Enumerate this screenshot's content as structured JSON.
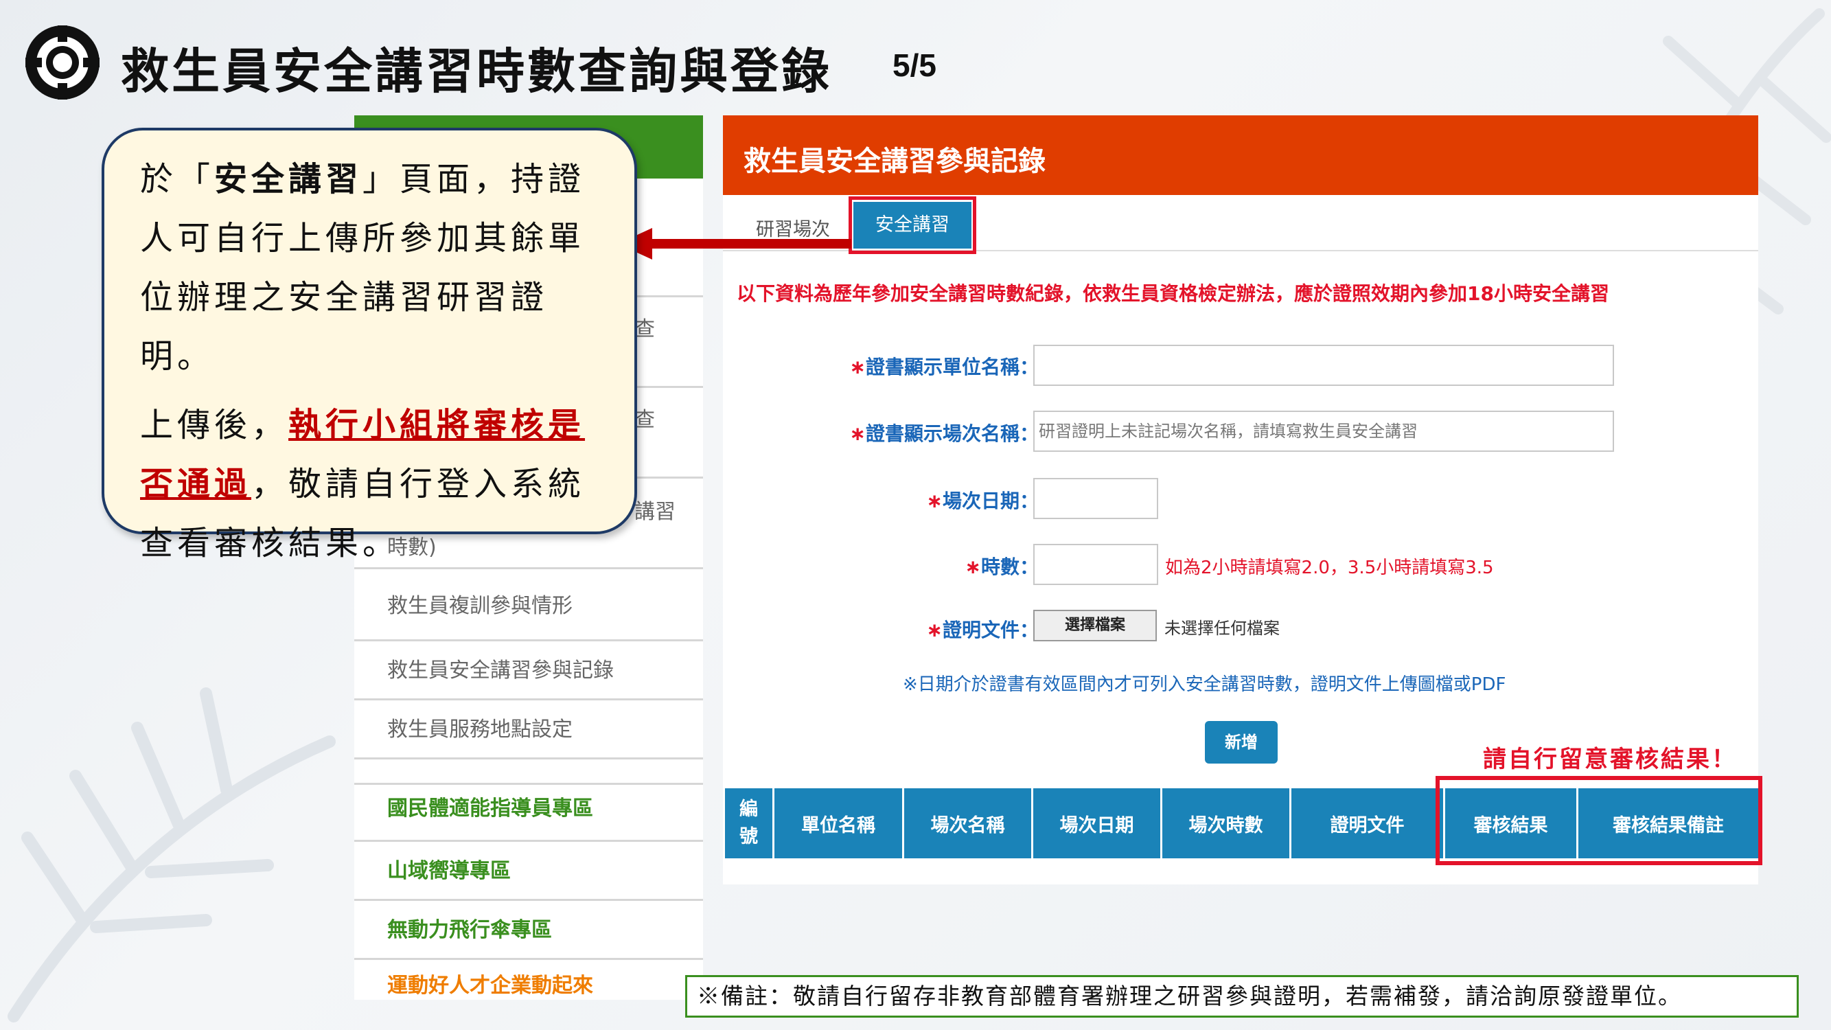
{
  "slide": {
    "title": "救生員安全講習時數查詢與登錄",
    "page": "5/5"
  },
  "callout": {
    "p1_pre": "於「",
    "p1_bold": "安全講習",
    "p1_post": "」頁面，持證人可自行上傳所參加其餘單位辦理之安全講習研習證明。",
    "p2_pre": "上傳後，",
    "p2_red": "執行小組將審核是否通過",
    "p2_post": "，敬請自行登入系統查看審核結果。"
  },
  "sidebar": {
    "fragments": [
      "查",
      "查",
      "講習",
      "時數)"
    ],
    "items": [
      "救生員複訓參與情形",
      "救生員安全講習參與記錄",
      "救生員服務地點設定",
      "國民體適能指導員專區",
      "山域嚮導專區",
      "無動力飛行傘專區",
      "運動好人才企業動起來"
    ]
  },
  "main": {
    "title": "救生員安全講習參與記錄",
    "tabs": [
      {
        "label": "研習場次",
        "active": false
      },
      {
        "label": "安全講習",
        "active": true
      }
    ],
    "notice": "以下資料為歷年參加安全講習時數紀錄，依救生員資格檢定辦法，應於證照效期內參加18小時安全講習",
    "form": {
      "unit_label": "證書顯示單位名稱：",
      "session_label": "證書顯示場次名稱：",
      "session_placeholder": "研習證明上未註記場次名稱，請填寫救生員安全講習",
      "date_label": "場次日期：",
      "hours_label": "時數：",
      "hours_hint": "如為2小時請填寫2.0，3.5小時請填寫3.5",
      "doc_label": "證明文件：",
      "file_button": "選擇檔案",
      "file_none": "未選擇任何檔案",
      "required_mark": "∗",
      "note": "※日期介於證書有效區間內才可列入安全講習時數，證明文件上傳圖檔或PDF",
      "add_button": "新增"
    },
    "review_note": "請自行留意審核結果！",
    "table_headers": [
      "編號",
      "單位名稱",
      "場次名稱",
      "場次日期",
      "場次時數",
      "證明文件",
      "審核結果",
      "審核結果備註"
    ]
  },
  "footer": "※備註：敬請自行留存非教育部體育署辦理之研習參與證明，若需補發，請洽詢原發證單位。",
  "colors": {
    "header_orange": "#e03d00",
    "table_blue": "#1a83b8",
    "highlight_red": "#e3132a",
    "sidebar_green": "#3a8f1f",
    "callout_border": "#1e3a66"
  },
  "icons": [
    "lifebuoy-logo-icon",
    "left-arrow-icon"
  ]
}
